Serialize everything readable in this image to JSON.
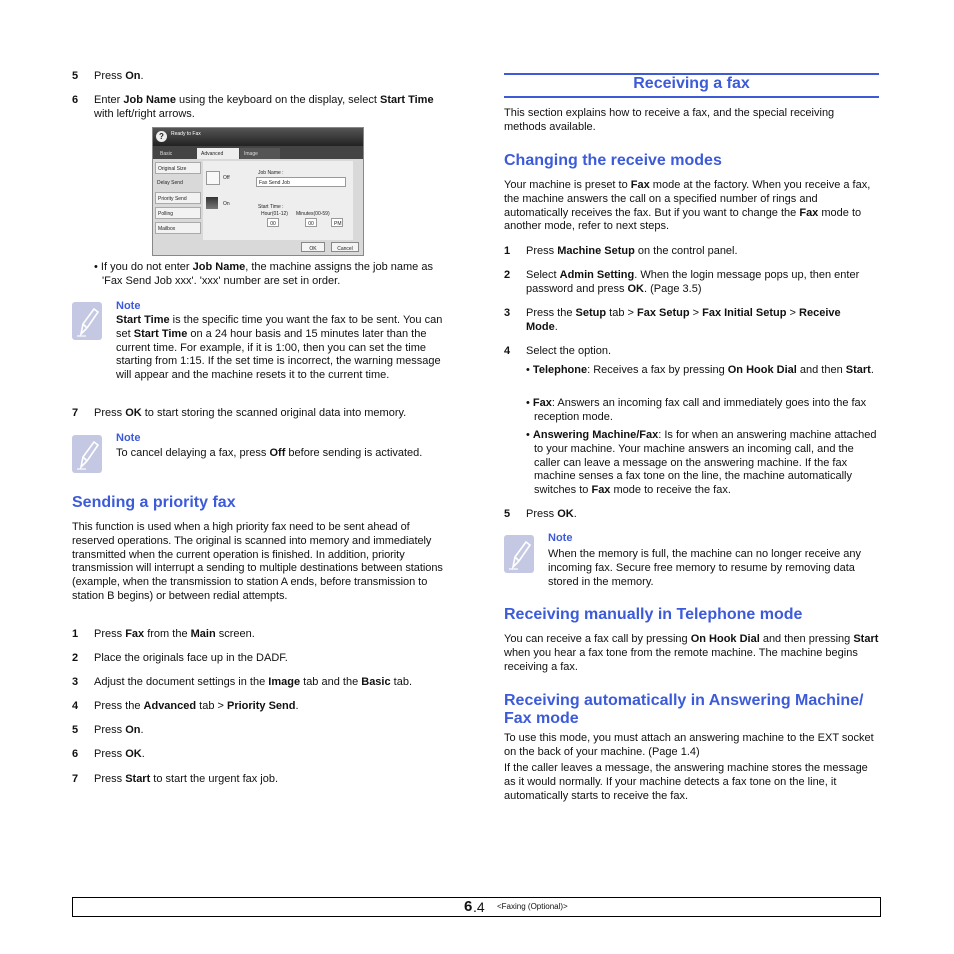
{
  "left": {
    "step5": {
      "n": "5",
      "text": [
        {
          "t": "Press "
        },
        {
          "t": "On",
          "b": true
        },
        {
          "t": "."
        }
      ]
    },
    "step6": {
      "n": "6",
      "text": [
        {
          "t": "Enter "
        },
        {
          "t": "Job Name",
          "b": true
        },
        {
          "t": " using the keyboard on the display, select "
        },
        {
          "t": "Start Time",
          "b": true
        },
        {
          "t": " with left/right arrows."
        }
      ]
    },
    "screenshot": {
      "title": "Ready to Fax",
      "tabs": [
        "Basic",
        "Advanced",
        "Image"
      ],
      "side": [
        "Original Size",
        "Delay Send",
        "Priority Send",
        "Polling",
        "Mailbox"
      ],
      "off": "Off",
      "on": "On",
      "job_name_label": "Job Name :",
      "job_name_value": "Fax Send Job",
      "start_time_label": "Start Time :",
      "hour_label": "Hour(01-12)",
      "minutes_label": "Minutes(00-59)",
      "hour": "00",
      "minutes": "00",
      "ampm": "PM",
      "ok": "OK",
      "cancel": "Cancel"
    },
    "bullet1": [
      {
        "t": "• If you do not enter "
      },
      {
        "t": "Job Name",
        "b": true
      },
      {
        "t": ", the machine assigns the job name as 'Fax Send Job xxx'. 'xxx' number are set in order."
      }
    ],
    "note1": {
      "label": "Note",
      "text": [
        {
          "t": "Start Time",
          "b": true
        },
        {
          "t": " is the specific time you want the fax to be sent. You can set "
        },
        {
          "t": "Start Time",
          "b": true
        },
        {
          "t": " on a 24 hour basis and 15 minutes later than the current time. For example, if it is 1:00, then you can set the time starting from 1:15. If the set time is incorrect, the warning message will appear and the machine resets it to the current time."
        }
      ]
    },
    "step7": {
      "n": "7",
      "text": [
        {
          "t": "Press "
        },
        {
          "t": "OK",
          "b": true
        },
        {
          "t": " to start storing the scanned original data into memory."
        }
      ]
    },
    "note2": {
      "label": "Note",
      "text": [
        {
          "t": "To cancel delaying a fax, press "
        },
        {
          "t": "Off",
          "b": true
        },
        {
          "t": " before sending is activated."
        }
      ]
    },
    "priority_heading": "Sending a priority fax",
    "priority_para": [
      {
        "t": "This function is used when a high priority fax need to be sent ahead of reserved operations. The original is scanned into memory and immediately transmitted when the current operation is finished. In addition, priority transmission will interrupt a sending to multiple destinations between stations (example, when the transmission to station A ends, before transmission to station B begins) or between redial attempts."
      }
    ],
    "priority_steps": [
      {
        "n": "1",
        "text": [
          {
            "t": "Press "
          },
          {
            "t": "Fax",
            "b": true
          },
          {
            "t": " from the "
          },
          {
            "t": "Main",
            "b": true
          },
          {
            "t": " screen."
          }
        ]
      },
      {
        "n": "2",
        "text": [
          {
            "t": "Place the originals face up in the DADF."
          }
        ]
      },
      {
        "n": "3",
        "text": [
          {
            "t": "Adjust the document settings in the "
          },
          {
            "t": "Image",
            "b": true
          },
          {
            "t": " tab and the "
          },
          {
            "t": "Basic",
            "b": true
          },
          {
            "t": " tab."
          }
        ]
      },
      {
        "n": "4",
        "text": [
          {
            "t": "Press the "
          },
          {
            "t": "Advanced",
            "b": true
          },
          {
            "t": " tab > "
          },
          {
            "t": "Priority Send",
            "b": true
          },
          {
            "t": "."
          }
        ]
      },
      {
        "n": "5",
        "text": [
          {
            "t": "Press "
          },
          {
            "t": "On",
            "b": true
          },
          {
            "t": "."
          }
        ]
      },
      {
        "n": "6",
        "text": [
          {
            "t": "Press "
          },
          {
            "t": "OK",
            "b": true
          },
          {
            "t": "."
          }
        ]
      },
      {
        "n": "7",
        "text": [
          {
            "t": "Press "
          },
          {
            "t": "Start",
            "b": true
          },
          {
            "t": " to start the urgent fax job."
          }
        ]
      }
    ]
  },
  "right": {
    "section_title": "Receiving a fax",
    "intro": [
      {
        "t": "This section explains how to receive a fax, and the special receiving methods available."
      }
    ],
    "modes_heading": "Changing the receive modes",
    "modes_para": [
      {
        "t": "Your machine is preset to "
      },
      {
        "t": "Fax",
        "b": true
      },
      {
        "t": " mode at the factory. When you receive a fax, the machine answers the call on a specified number of rings and automatically receives the fax. But if you want to change the "
      },
      {
        "t": "Fax",
        "b": true
      },
      {
        "t": " mode to another mode, refer to next steps."
      }
    ],
    "steps": [
      {
        "n": "1",
        "text": [
          {
            "t": "Press "
          },
          {
            "t": "Machine Setup",
            "b": true
          },
          {
            "t": " on the control panel."
          }
        ]
      },
      {
        "n": "2",
        "text": [
          {
            "t": "Select "
          },
          {
            "t": "Admin Setting",
            "b": true
          },
          {
            "t": ". When the login message pops up, then enter password and press "
          },
          {
            "t": "OK",
            "b": true
          },
          {
            "t": ". (Page 3.5)"
          }
        ]
      },
      {
        "n": "3",
        "text": [
          {
            "t": "Press the "
          },
          {
            "t": "Setup",
            "b": true
          },
          {
            "t": " tab > "
          },
          {
            "t": "Fax Setup",
            "b": true
          },
          {
            "t": " > "
          },
          {
            "t": "Fax Initial Setup",
            "b": true
          },
          {
            "t": " > "
          },
          {
            "t": "Receive Mode",
            "b": true
          },
          {
            "t": "."
          }
        ]
      },
      {
        "n": "4",
        "text": [
          {
            "t": "Select the option."
          }
        ]
      }
    ],
    "options": [
      [
        {
          "t": "• "
        },
        {
          "t": "Telephone",
          "b": true
        },
        {
          "t": ": Receives a fax by pressing "
        },
        {
          "t": "On Hook Dial",
          "b": true
        },
        {
          "t": " and then "
        },
        {
          "t": "Start",
          "b": true
        },
        {
          "t": "."
        }
      ],
      [
        {
          "t": "• "
        },
        {
          "t": "Fax",
          "b": true
        },
        {
          "t": ": Answers an incoming fax call and immediately goes into the fax reception mode."
        }
      ],
      [
        {
          "t": "• "
        },
        {
          "t": "Answering Machine/Fax",
          "b": true
        },
        {
          "t": ": Is for when an answering machine attached to your machine. Your machine answers an incoming call, and the caller can leave a message on the answering machine. If the fax machine senses a fax tone on the line, the machine automatically switches to "
        },
        {
          "t": "Fax",
          "b": true
        },
        {
          "t": " mode to receive the fax."
        }
      ]
    ],
    "step5": {
      "n": "5",
      "text": [
        {
          "t": "Press "
        },
        {
          "t": "OK",
          "b": true
        },
        {
          "t": "."
        }
      ]
    },
    "note": {
      "label": "Note",
      "text": [
        {
          "t": "When the memory is full, the machine can no longer receive any incoming fax. Secure free memory to resume by removing data stored in the memory."
        }
      ]
    },
    "manual_heading": "Receiving manually in Telephone mode",
    "manual_para": [
      {
        "t": "You can receive a fax call by pressing "
      },
      {
        "t": "On Hook Dial",
        "b": true
      },
      {
        "t": " and then pressing "
      },
      {
        "t": "Start",
        "b": true
      },
      {
        "t": " when you hear a fax tone from the remote machine. The machine begins receiving a fax."
      }
    ],
    "auto_heading": "Receiving automatically in Answering Machine/ Fax mode",
    "auto_para1": [
      {
        "t": "To use this mode, you must attach an answering machine to the EXT socket on the back of your machine. (Page 1.4)"
      }
    ],
    "auto_para2": [
      {
        "t": "If the caller leaves a message, the answering machine stores the message as it would normally. If your machine detects a fax tone on the line, it automatically starts to receive the fax."
      }
    ]
  },
  "footer": {
    "chapter": "6",
    "page": ".4",
    "section": "<Faxing (Optional)>"
  },
  "colors": {
    "heading": "#3d5bd9",
    "note_icon": "#c5c8e2"
  }
}
